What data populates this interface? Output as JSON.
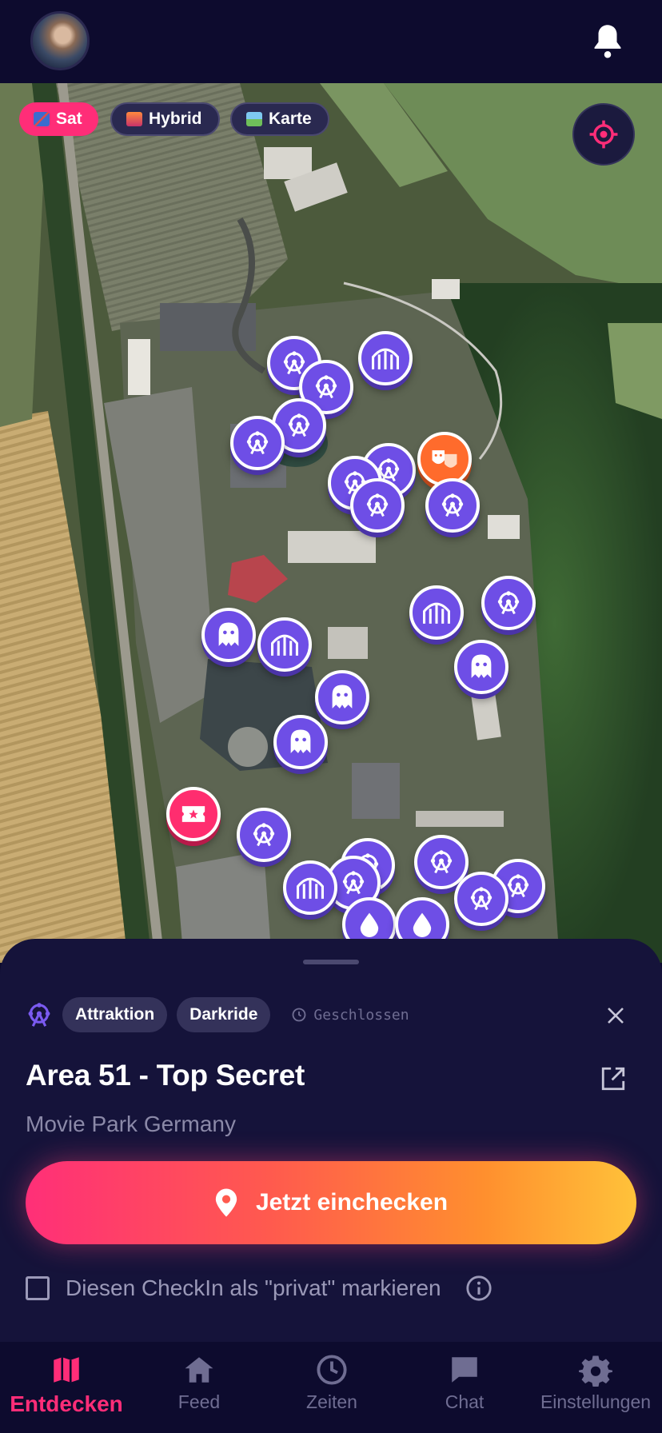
{
  "colors": {
    "accent": "#ff2d78",
    "pin": "#6e4ee6",
    "background": "#0d0b2e",
    "sheet": "#15133a"
  },
  "header": {
    "avatar_icon": "user-avatar",
    "notification_icon": "bell-icon"
  },
  "map": {
    "types": [
      {
        "label": "Sat",
        "icon": "satellite-icon",
        "active": true
      },
      {
        "label": "Hybrid",
        "icon": "city-icon",
        "active": false
      },
      {
        "label": "Karte",
        "icon": "map-icon",
        "active": false
      }
    ],
    "locate_icon": "crosshair-icon",
    "pins": [
      "ferris-wheel-icon",
      "ferris-wheel-icon",
      "ferris-wheel-icon",
      "ferris-wheel-icon",
      "roller-coaster-icon",
      "ferris-wheel-icon",
      "ferris-wheel-icon",
      "theater-masks-icon",
      "ferris-wheel-icon",
      "ferris-wheel-icon",
      "ghost-icon",
      "roller-coaster-icon",
      "roller-coaster-icon",
      "ferris-wheel-icon",
      "ghost-icon",
      "ghost-icon",
      "ghost-icon",
      "ticket-icon",
      "ferris-wheel-icon",
      "roller-coaster-icon",
      "ferris-wheel-icon",
      "ferris-wheel-icon",
      "ferris-wheel-icon",
      "ferris-wheel-icon",
      "ferris-wheel-icon",
      "water-drop-icon",
      "water-drop-icon"
    ]
  },
  "detail": {
    "category_icon": "ferris-wheel-icon",
    "tags": [
      "Attraktion",
      "Darkride"
    ],
    "status": "Geschlossen",
    "title": "Area 51 - Top Secret",
    "park": "Movie Park Germany",
    "checkin_label": "Jetzt einchecken",
    "private_label": "Diesen CheckIn als \"privat\" markieren",
    "private_checked": false
  },
  "tabs": [
    {
      "label": "Entdecken",
      "icon": "map-icon",
      "active": true
    },
    {
      "label": "Feed",
      "icon": "home-icon",
      "active": false
    },
    {
      "label": "Zeiten",
      "icon": "clock-icon",
      "active": false
    },
    {
      "label": "Chat",
      "icon": "chat-icon",
      "active": false
    },
    {
      "label": "Einstellungen",
      "icon": "gear-icon",
      "active": false
    }
  ]
}
